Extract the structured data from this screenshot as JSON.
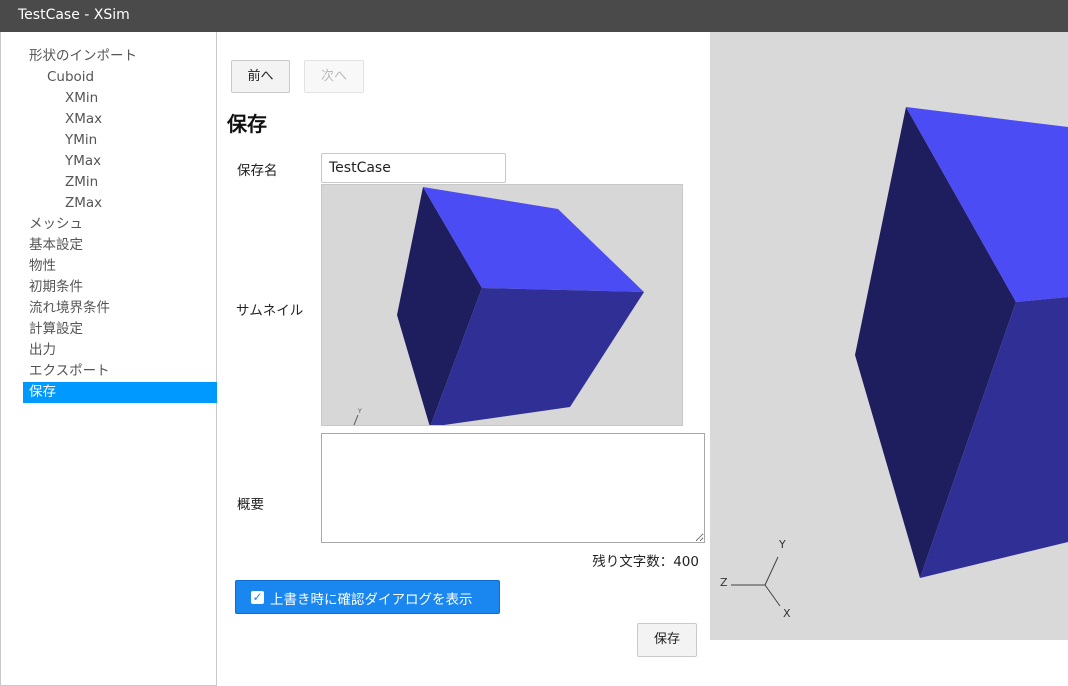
{
  "window": {
    "title": "TestCase - XSim"
  },
  "sidebar": {
    "items": [
      {
        "label": "形状のインポート",
        "level": 0,
        "active": false
      },
      {
        "label": "Cuboid",
        "level": 1,
        "active": false
      },
      {
        "label": "XMin",
        "level": 2,
        "active": false
      },
      {
        "label": "XMax",
        "level": 2,
        "active": false
      },
      {
        "label": "YMin",
        "level": 2,
        "active": false
      },
      {
        "label": "YMax",
        "level": 2,
        "active": false
      },
      {
        "label": "ZMin",
        "level": 2,
        "active": false
      },
      {
        "label": "ZMax",
        "level": 2,
        "active": false
      },
      {
        "label": "メッシュ",
        "level": 0,
        "active": false
      },
      {
        "label": "基本設定",
        "level": 0,
        "active": false
      },
      {
        "label": "物性",
        "level": 0,
        "active": false
      },
      {
        "label": "初期条件",
        "level": 0,
        "active": false
      },
      {
        "label": "流れ境界条件",
        "level": 0,
        "active": false
      },
      {
        "label": "計算設定",
        "level": 0,
        "active": false
      },
      {
        "label": "出力",
        "level": 0,
        "active": false
      },
      {
        "label": "エクスポート",
        "level": 0,
        "active": false
      },
      {
        "label": "保存",
        "level": 0,
        "active": true
      }
    ]
  },
  "nav": {
    "prev_label": "前へ",
    "next_label": "次へ"
  },
  "form": {
    "section_title": "保存",
    "name_label": "保存名",
    "name_value": "TestCase",
    "thumbnail_label": "サムネイル",
    "summary_label": "概要",
    "summary_value": "",
    "remaining_text": "残り文字数：400",
    "confirm_dialog_label": "上書き時に確認ダイアログを表示",
    "confirm_dialog_checked": true,
    "save_label": "保存"
  },
  "viewport": {
    "axis_labels": {
      "x": "X",
      "y": "Y",
      "z": "Z"
    },
    "thumbnail_axis_label": "Y"
  },
  "colors": {
    "cube_top": "#4c4cf5",
    "cube_front": "#2f2f96",
    "cube_side": "#1e1e5e",
    "viewport_bg": "#d9d9d9",
    "accent": "#1a86f0",
    "sidebar_active": "#0099ff"
  }
}
